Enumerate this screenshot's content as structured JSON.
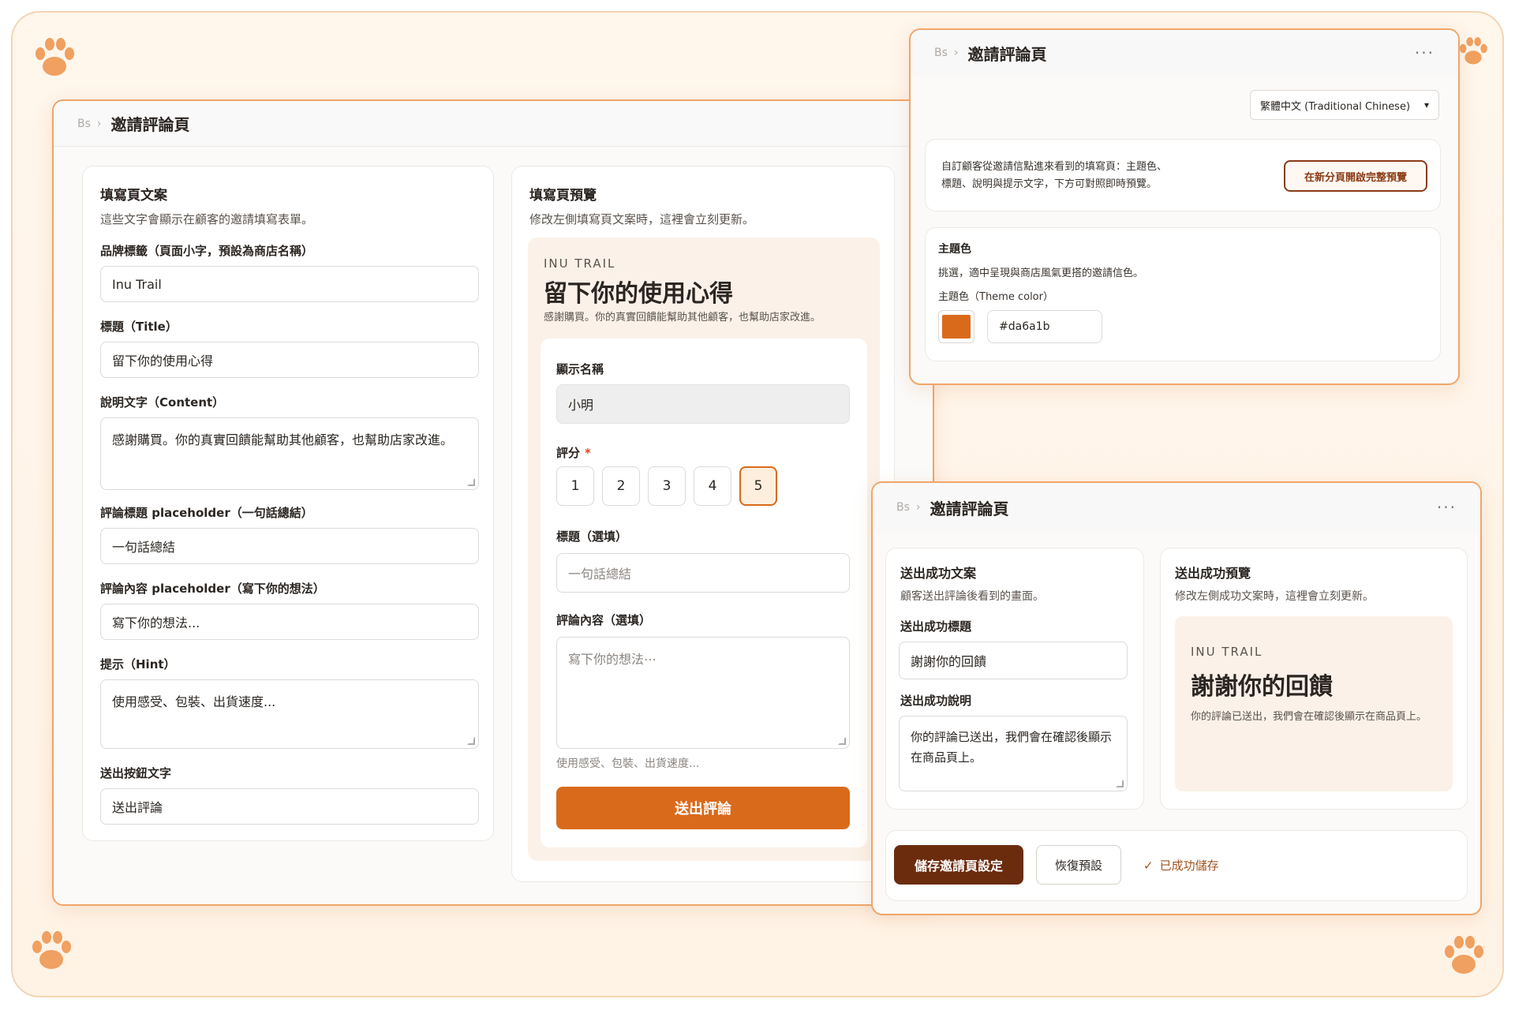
{
  "colors": {
    "accent": "#da6a1b",
    "dark_brown": "#6b2c0e",
    "frame": "#efa56a"
  },
  "main_window": {
    "breadcrumb_icon": "Bs",
    "title": "邀請評論頁",
    "copy_card": {
      "title": "填寫頁文案",
      "description": "這些文字會顯示在顧客的邀請填寫表單。",
      "brand_label": "品牌標籤（頁面小字，預設為商店名稱）",
      "brand_value": "Inu Trail",
      "title_label": "標題（Title）",
      "title_value": "留下你的使用心得",
      "content_label": "說明文字（Content）",
      "content_value": "感謝購買。你的真實回饋能幫助其他顧客，也幫助店家改進。",
      "review_title_ph_label": "評論標題 placeholder（一句話總結）",
      "review_title_ph_value": "一句話總結",
      "review_content_ph_label": "評論內容 placeholder（寫下你的想法）",
      "review_content_ph_value": "寫下你的想法...",
      "hint_label": "提示（Hint）",
      "hint_value": "使用感受、包裝、出貨速度...",
      "submit_label": "送出按鈕文字",
      "submit_value": "送出評論"
    },
    "preview_card": {
      "title": "填寫頁預覽",
      "description": "修改左側填寫頁文案時，這裡會立刻更新。",
      "brand": "INU TRAIL",
      "heading": "留下你的使用心得",
      "subtext": "感謝購買。你的真實回饋能幫助其他顧客，也幫助店家改進。",
      "name_label": "顯示名稱",
      "name_value": "小明",
      "rating_label": "評分",
      "rating_required": "*",
      "ratings": [
        "1",
        "2",
        "3",
        "4",
        "5"
      ],
      "selected_rating": 5,
      "review_title_label": "標題（選填）",
      "review_title_placeholder": "一句話總結",
      "review_content_label": "評論內容（選填）",
      "review_content_placeholder": "寫下你的想法⋯",
      "hint": "使用感受、包裝、出貨速度...",
      "submit_button": "送出評論"
    }
  },
  "theme_window": {
    "breadcrumb_icon": "Bs",
    "title": "邀請評論頁",
    "more": "···",
    "language_select": "繁體中文 (Traditional Chinese)",
    "info_line1": "自訂顧客從邀請信點進來看到的填寫頁：主題色、",
    "info_line2": "標題、說明與提示文字，下方可對照即時預覽。",
    "open_preview_button": "在新分頁開啟完整預覽",
    "theme_title": "主題色",
    "theme_desc": "挑選，適中呈現與商店風氣更搭的邀請信色。",
    "theme_label": "主題色（Theme color）",
    "theme_value": "#da6a1b"
  },
  "success_window": {
    "breadcrumb_icon": "Bs",
    "title": "邀請評論頁",
    "more": "···",
    "copy_card": {
      "title": "送出成功文案",
      "description": "顧客送出評論後看到的畫面。",
      "success_title_label": "送出成功標題",
      "success_title_value": "謝謝你的回饋",
      "success_desc_label": "送出成功說明",
      "success_desc_value": "你的評論已送出，我們會在確認後顯示在商品頁上。"
    },
    "preview_card": {
      "title": "送出成功預覽",
      "description": "修改左側成功文案時，這裡會立刻更新。",
      "brand": "INU TRAIL",
      "heading": "謝謝你的回饋",
      "body": "你的評論已送出，我們會在確認後顯示在商品頁上。"
    },
    "actions": {
      "save_button": "儲存邀請頁設定",
      "reset_button": "恢復預設",
      "saved_status": "已成功儲存"
    }
  }
}
